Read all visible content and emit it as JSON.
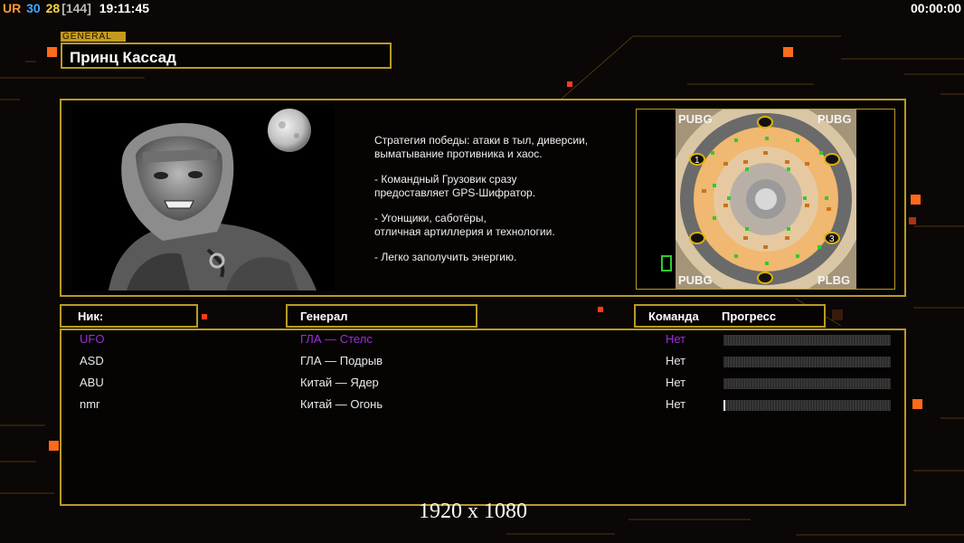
{
  "hud": {
    "ur_label": "UR",
    "stat_a": "30",
    "stat_b": "28",
    "stat_c": "[144]",
    "clock": "19:11:45",
    "game_timer": "00:00:00"
  },
  "general": {
    "tag": "GENERAL",
    "name": "Принц Кассад",
    "description": [
      "Стратегия победы: атаки в тыл, диверсии,\n выматывание противника и хаос.",
      "- Командный Грузовик сразу\nпредоставляет GPS-Шифратор.",
      "- Угонщики, саботёры,\nотличная артиллерия и технологии.",
      "- Легко заполучить энергию."
    ]
  },
  "minimap": {
    "corner_labels": [
      "PUBG",
      "PUBG",
      "PUBG",
      "PLBG"
    ],
    "start_positions": [
      "1",
      "3"
    ]
  },
  "columns": {
    "nick": "Ник:",
    "general": "Генерал",
    "team": "Команда",
    "progress": "Прогресс"
  },
  "players": [
    {
      "nick": "UFO",
      "general": "ГЛА — Стелс",
      "team": "Нет",
      "progress": 0.0,
      "color": "#9b30d9"
    },
    {
      "nick": "ASD",
      "general": "ГЛА — Подрыв",
      "team": "Нет",
      "progress": 0.0,
      "color": "#e8e8e8"
    },
    {
      "nick": "ABU",
      "general": "Китай — Ядер",
      "team": "Нет",
      "progress": 0.0,
      "color": "#e8e8e8"
    },
    {
      "nick": "nmr",
      "general": "Китай — Огонь",
      "team": "Нет",
      "progress": 0.01,
      "color": "#e8e8e8"
    }
  ],
  "overlay": {
    "resolution": "1920 x 1080"
  },
  "colors": {
    "frame": "#b89a24",
    "accent_orange": "#ff6a1a",
    "player_highlight": "#9b30d9"
  }
}
